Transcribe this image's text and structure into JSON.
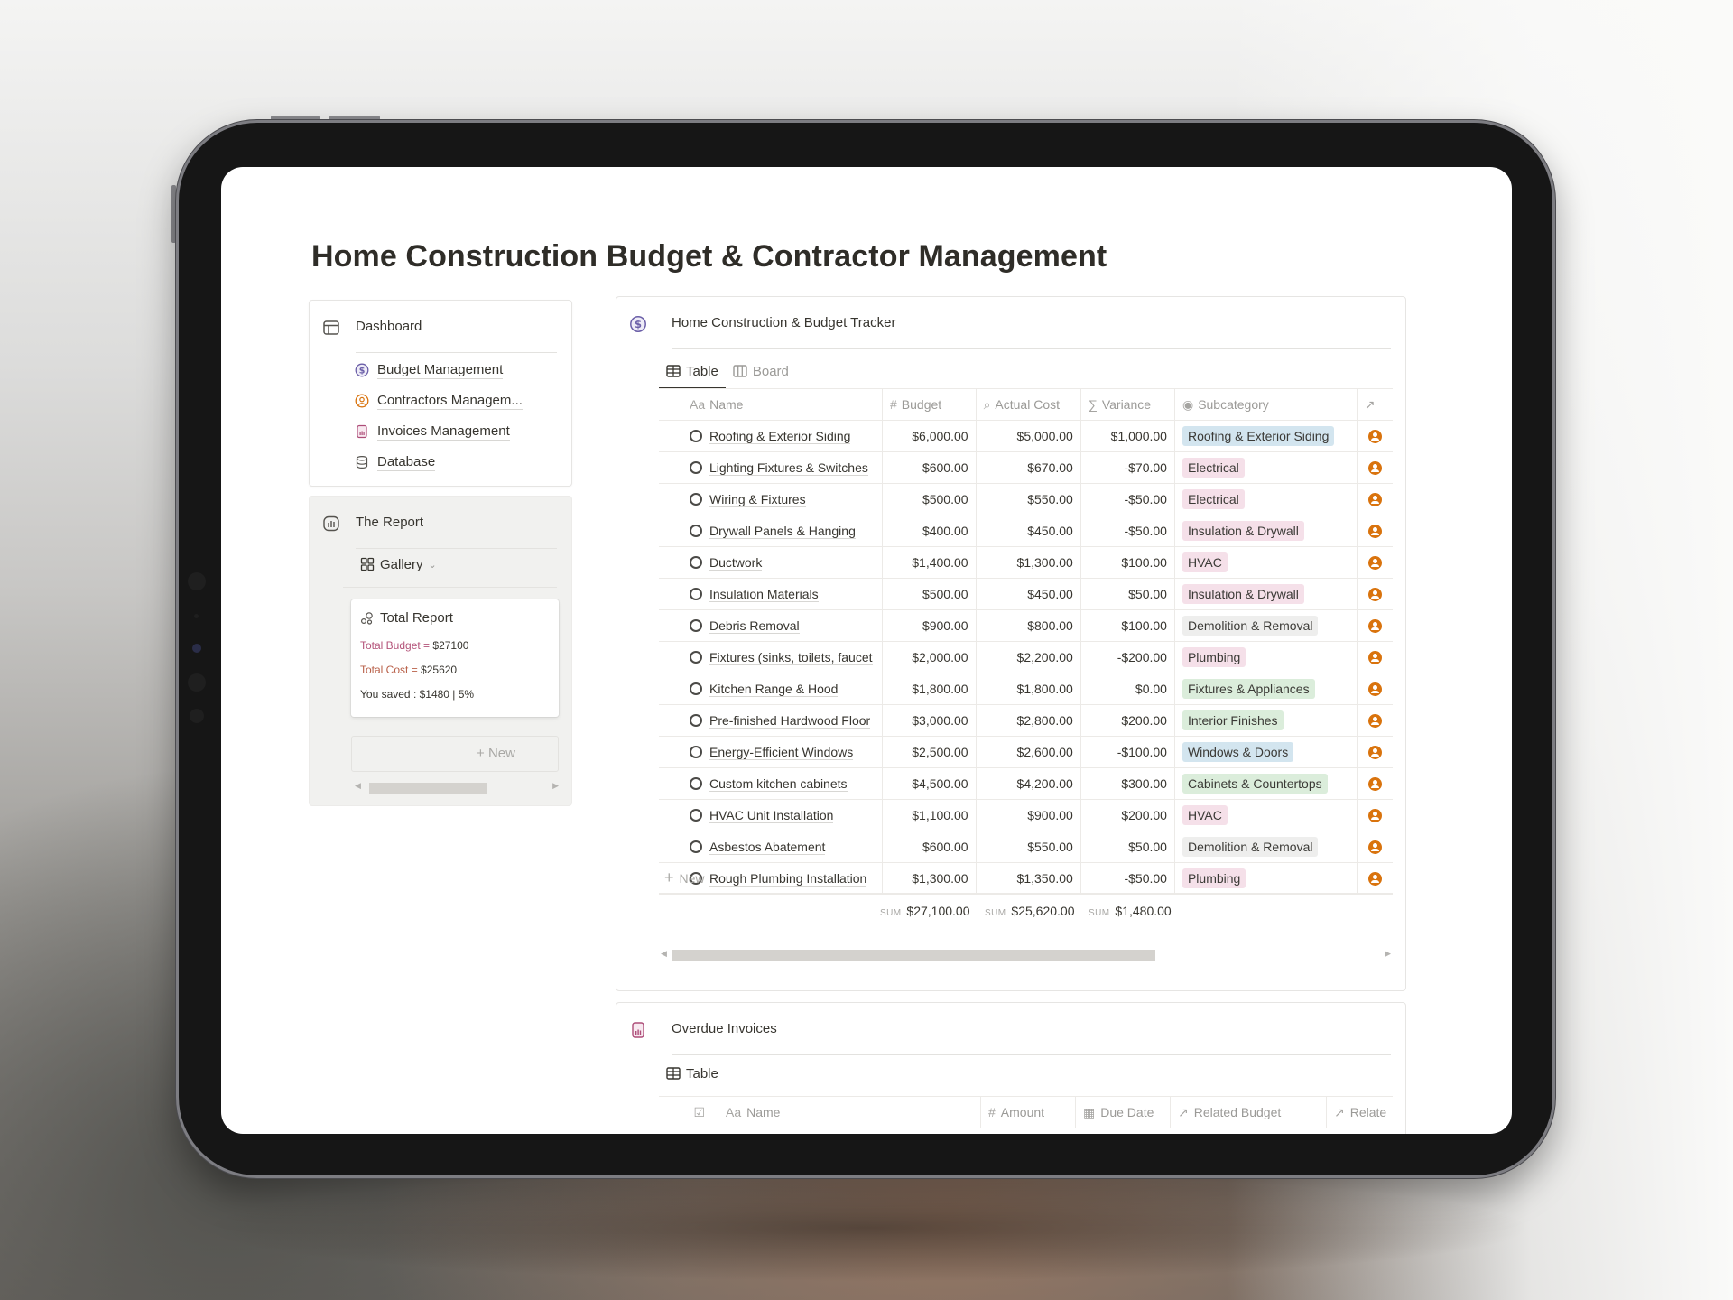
{
  "page": {
    "title": "Home Construction Budget & Contractor Management"
  },
  "nav_card": {
    "heading": "Dashboard",
    "heading_icon": "layout-icon",
    "items": [
      {
        "label": "Budget Management",
        "icon": "dollar-circle-icon",
        "color": "#6b5fa8"
      },
      {
        "label": "Contractors Managem...",
        "icon": "person-circle-icon",
        "color": "#d9730d"
      },
      {
        "label": "Invoices Management",
        "icon": "invoice-icon",
        "color": "#ad4d78"
      },
      {
        "label": "Database",
        "icon": "database-icon",
        "color": "#55534e"
      }
    ]
  },
  "report_card": {
    "heading": "The Report",
    "heading_icon": "chart-icon",
    "view_label": "Gallery",
    "gallery_card": {
      "title": "Total Report",
      "budget_label": "Total Budget =",
      "budget_value": "$27100",
      "cost_label": "Total Cost =",
      "cost_value": "$25620",
      "saved_text": "You saved : $1480 | 5%"
    },
    "new_label": "New"
  },
  "tracker": {
    "heading": "Home Construction & Budget Tracker",
    "tabs": [
      {
        "label": "Table",
        "active": true
      },
      {
        "label": "Board",
        "active": false
      }
    ],
    "columns": [
      {
        "icon": "Aa",
        "label": "Name"
      },
      {
        "icon": "#",
        "label": "Budget"
      },
      {
        "icon": "⌕",
        "label": "Actual Cost"
      },
      {
        "icon": "∑",
        "label": "Variance"
      },
      {
        "icon": "◉",
        "label": "Subcategory"
      },
      {
        "icon": "↗",
        "label": ""
      }
    ],
    "rows": [
      {
        "name": "Roofing & Exterior Siding",
        "budget": "$6,000.00",
        "actual": "$5,000.00",
        "variance": "$1,000.00",
        "subcategory": "Roofing & Exterior Siding",
        "tag_color": "blue"
      },
      {
        "name": "Lighting Fixtures & Switches",
        "budget": "$600.00",
        "actual": "$670.00",
        "variance": "-$70.00",
        "subcategory": "Electrical",
        "tag_color": "pink"
      },
      {
        "name": "Wiring & Fixtures",
        "budget": "$500.00",
        "actual": "$550.00",
        "variance": "-$50.00",
        "subcategory": "Electrical",
        "tag_color": "pink"
      },
      {
        "name": "Drywall Panels & Hanging",
        "budget": "$400.00",
        "actual": "$450.00",
        "variance": "-$50.00",
        "subcategory": "Insulation & Drywall",
        "tag_color": "pink"
      },
      {
        "name": "Ductwork",
        "budget": "$1,400.00",
        "actual": "$1,300.00",
        "variance": "$100.00",
        "subcategory": "HVAC",
        "tag_color": "pink"
      },
      {
        "name": "Insulation Materials",
        "budget": "$500.00",
        "actual": "$450.00",
        "variance": "$50.00",
        "subcategory": "Insulation & Drywall",
        "tag_color": "pink"
      },
      {
        "name": "Debris Removal",
        "budget": "$900.00",
        "actual": "$800.00",
        "variance": "$100.00",
        "subcategory": "Demolition & Removal",
        "tag_color": "gray"
      },
      {
        "name": "Fixtures (sinks, toilets, faucet",
        "budget": "$2,000.00",
        "actual": "$2,200.00",
        "variance": "-$200.00",
        "subcategory": "Plumbing",
        "tag_color": "pink"
      },
      {
        "name": "Kitchen Range & Hood",
        "budget": "$1,800.00",
        "actual": "$1,800.00",
        "variance": "$0.00",
        "subcategory": "Fixtures & Appliances",
        "tag_color": "green"
      },
      {
        "name": "Pre-finished Hardwood Floor",
        "budget": "$3,000.00",
        "actual": "$2,800.00",
        "variance": "$200.00",
        "subcategory": "Interior Finishes",
        "tag_color": "green"
      },
      {
        "name": "Energy-Efficient Windows",
        "budget": "$2,500.00",
        "actual": "$2,600.00",
        "variance": "-$100.00",
        "subcategory": "Windows & Doors",
        "tag_color": "blue"
      },
      {
        "name": "Custom kitchen cabinets",
        "budget": "$4,500.00",
        "actual": "$4,200.00",
        "variance": "$300.00",
        "subcategory": "Cabinets & Countertops",
        "tag_color": "green"
      },
      {
        "name": "HVAC Unit Installation",
        "budget": "$1,100.00",
        "actual": "$900.00",
        "variance": "$200.00",
        "subcategory": "HVAC",
        "tag_color": "pink"
      },
      {
        "name": "Asbestos Abatement",
        "budget": "$600.00",
        "actual": "$550.00",
        "variance": "$50.00",
        "subcategory": "Demolition & Removal",
        "tag_color": "gray"
      },
      {
        "name": "Rough Plumbing Installation",
        "budget": "$1,300.00",
        "actual": "$1,350.00",
        "variance": "-$50.00",
        "subcategory": "Plumbing",
        "tag_color": "pink"
      }
    ],
    "new_label": "New",
    "sum_label": "SUM",
    "sums": {
      "budget": "$27,100.00",
      "actual": "$25,620.00",
      "variance": "$1,480.00"
    }
  },
  "overdue": {
    "heading": "Overdue Invoices",
    "tab_label": "Table",
    "columns": [
      {
        "icon": "☑",
        "label": ""
      },
      {
        "icon": "Aa",
        "label": "Name"
      },
      {
        "icon": "#",
        "label": "Amount"
      },
      {
        "icon": "▦",
        "label": "Due Date"
      },
      {
        "icon": "↗",
        "label": "Related Budget"
      },
      {
        "icon": "↗",
        "label": "Relate"
      }
    ]
  }
}
